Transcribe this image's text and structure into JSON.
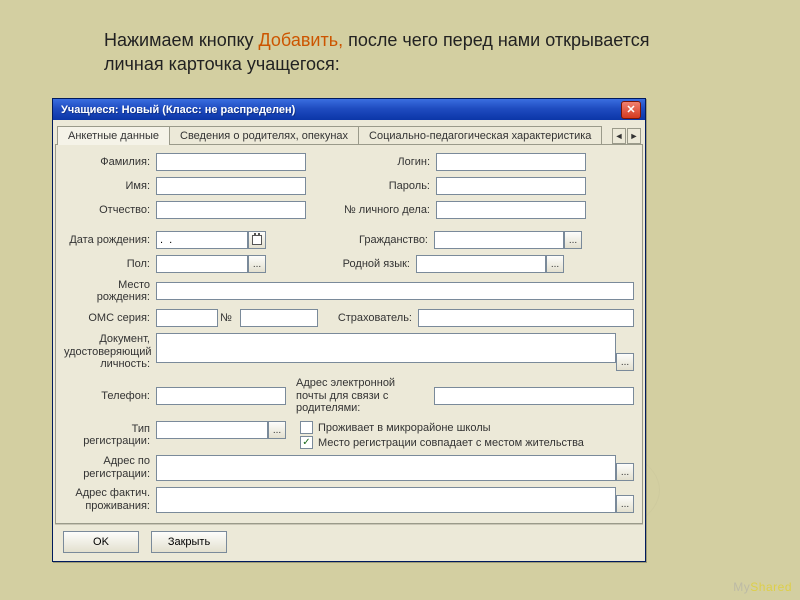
{
  "slide": {
    "text_before": "Нажимаем кнопку ",
    "text_hl": "Добавить,",
    "text_after": " после чего перед нами открывается личная карточка учащегося:"
  },
  "watermark": {
    "left": "My",
    "right": "Shared"
  },
  "window": {
    "title": "Учащиеся: Новый (Класс: не распределен)"
  },
  "tabs": {
    "t1": "Анкетные данные",
    "t2": "Сведения о родителях, опекунах",
    "t3": "Социально-педагогическая характеристика"
  },
  "labels": {
    "surname": "Фамилия:",
    "name": "Имя:",
    "patronymic": "Отчество:",
    "login": "Логин:",
    "password": "Пароль:",
    "file_no": "№ личного дела:",
    "dob": "Дата рождения:",
    "dob_value": ".  .",
    "citizenship": "Гражданство:",
    "sex": "Пол:",
    "native_lang": "Родной язык:",
    "birthplace": "Место рождения:",
    "oms_series": "ОМС серия:",
    "oms_no": "№",
    "insurer": "Страхователь:",
    "id_doc": "Документ, удостоверяющий личность:",
    "phone": "Телефон:",
    "email_note": "Адрес электронной почты для связи с родителями:",
    "reg_type": "Тип регистрации:",
    "chk_micro": "Проживает в микрорайоне школы",
    "chk_match": "Место регистрации совпадает с местом жительства",
    "reg_addr": "Адрес по регистрации:",
    "live_addr": "Адрес фактич. проживания:"
  },
  "values": {
    "surname": "",
    "name": "",
    "patronymic": "",
    "login": "",
    "password": "",
    "file_no": "",
    "citizenship": "",
    "sex": "",
    "native_lang": "",
    "birthplace": "",
    "oms_series": "",
    "oms_no": "",
    "insurer": "",
    "id_doc": "",
    "phone": "",
    "email": "",
    "reg_type": "",
    "reg_addr": "",
    "live_addr": "",
    "chk_micro": false,
    "chk_match": true
  },
  "buttons": {
    "ok": "OK",
    "close": "Закрыть",
    "ellipsis": "..."
  }
}
